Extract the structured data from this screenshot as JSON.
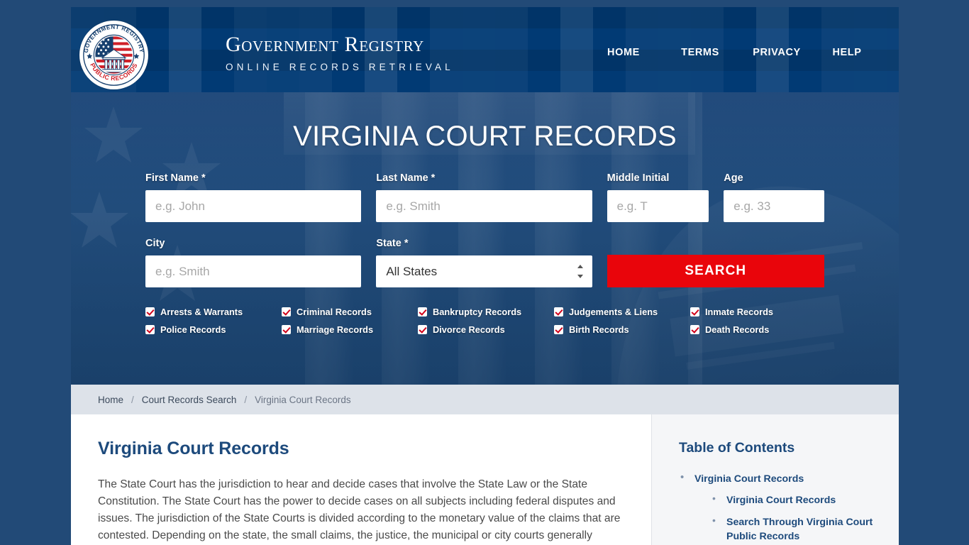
{
  "site": {
    "brand_title": "Government Registry",
    "brand_subtitle": "ONLINE RECORDS RETRIEVAL",
    "logo_top_text": "GOVERNMENT REGISTRY",
    "logo_bottom_text": "PUBLIC RECORDS"
  },
  "nav": {
    "items": [
      {
        "label": "HOME"
      },
      {
        "label": "TERMS"
      },
      {
        "label": "PRIVACY"
      },
      {
        "label": "HELP"
      }
    ]
  },
  "hero": {
    "title": "VIRGINIA COURT RECORDS"
  },
  "form": {
    "first_name": {
      "label": "First Name *",
      "placeholder": "e.g. John",
      "value": ""
    },
    "last_name": {
      "label": "Last Name *",
      "placeholder": "e.g. Smith",
      "value": ""
    },
    "middle_initial": {
      "label": "Middle Initial",
      "placeholder": "e.g. T",
      "value": ""
    },
    "age": {
      "label": "Age",
      "placeholder": "e.g. 33",
      "value": ""
    },
    "city": {
      "label": "City",
      "placeholder": "e.g. Smith",
      "value": ""
    },
    "state": {
      "label": "State *",
      "selected": "All States"
    },
    "search_button": "SEARCH"
  },
  "checkboxes": [
    {
      "label": "Arrests & Warrants",
      "checked": true
    },
    {
      "label": "Criminal Records",
      "checked": true
    },
    {
      "label": "Bankruptcy Records",
      "checked": true
    },
    {
      "label": "Judgements & Liens",
      "checked": true
    },
    {
      "label": "Inmate Records",
      "checked": true
    },
    {
      "label": "Police Records",
      "checked": true
    },
    {
      "label": "Marriage Records",
      "checked": true
    },
    {
      "label": "Divorce Records",
      "checked": true
    },
    {
      "label": "Birth Records",
      "checked": true
    },
    {
      "label": "Death Records",
      "checked": true
    }
  ],
  "breadcrumb": {
    "home": "Home",
    "separator": "/",
    "parent": "Court Records Search",
    "current": "Virginia Court Records"
  },
  "article": {
    "heading": "Virginia Court Records",
    "paragraph": "The State Court has the jurisdiction to hear and decide cases that involve the State Law or the State Constitution. The State Court has the power to decide cases on all subjects including federal disputes and issues. The jurisdiction of the State Courts is divided according to the monetary value of the claims that are contested. Depending on the state, the small claims, the justice, the municipal or city courts generally"
  },
  "sidebar": {
    "heading": "Table of Contents",
    "items": [
      {
        "label": "Virginia Court Records",
        "children": [
          {
            "label": "Virginia Court Records"
          },
          {
            "label": "Search Through Virginia Court Public Records"
          }
        ]
      }
    ]
  },
  "colors": {
    "header_blue": "#013a74",
    "hero_blue": "#255182",
    "accent_red": "#e9050b",
    "heading_blue": "#1d4a7c",
    "page_bg": "#224a77"
  }
}
